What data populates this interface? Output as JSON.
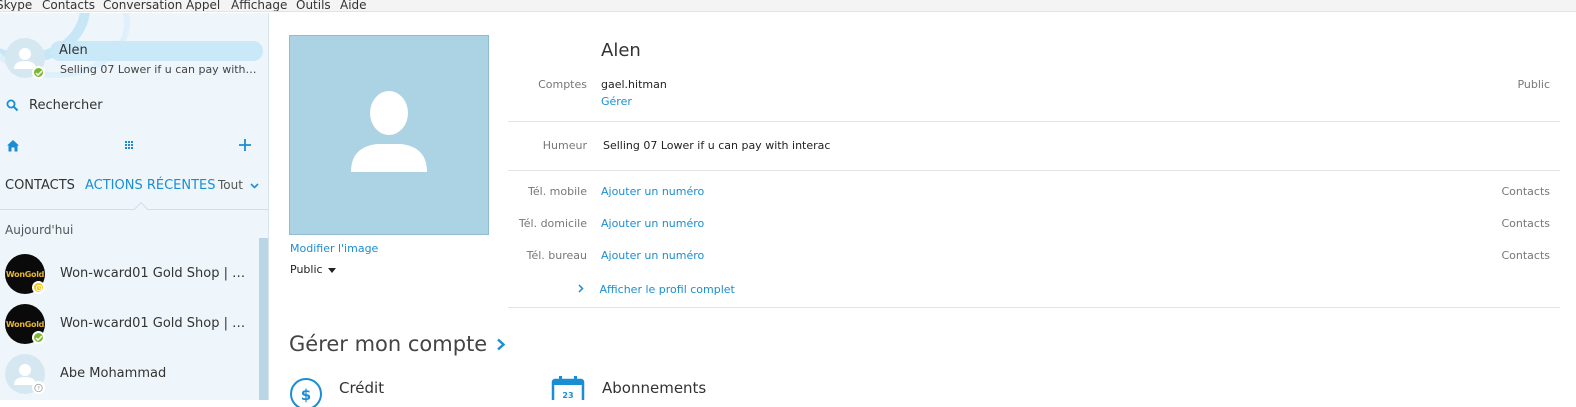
{
  "menu": [
    "Skype",
    "Contacts",
    "Conversation",
    "Appel",
    "Affichage",
    "Outils",
    "Aide"
  ],
  "me": {
    "name": "Alen",
    "mood": "Selling 07 Lower if u can pay with in..."
  },
  "search": {
    "label": "Rechercher"
  },
  "tabs": {
    "contacts": "CONTACTS",
    "recent": "ACTIONS RÉCENTES",
    "filter": "Tout"
  },
  "section_today": "Aujourd'hui",
  "contacts_list": [
    {
      "name": "Won-wcard01 Gold Shop | Al...",
      "avatar_text": "WonGold",
      "status": "away"
    },
    {
      "name": "Won-wcard01 Gold Shop |  b...",
      "avatar_text": "WonGold",
      "status": "online"
    },
    {
      "name": "Abe Mohammad",
      "avatar_text": "",
      "status": "unknown"
    }
  ],
  "profile": {
    "name": "Alen",
    "modify_image": "Modifier l'image",
    "visibility": "Public",
    "accounts_label": "Comptes",
    "account_id": "gael.hitman",
    "manage_link": "Gérer",
    "accounts_scope": "Public",
    "mood_label": "Humeur",
    "mood": "Selling 07 Lower if u can pay with interac",
    "phones": [
      {
        "label": "Tél. mobile",
        "action": "Ajouter un numéro",
        "scope": "Contacts"
      },
      {
        "label": "Tél. domicile",
        "action": "Ajouter un numéro",
        "scope": "Contacts"
      },
      {
        "label": "Tél. bureau",
        "action": "Ajouter un numéro",
        "scope": "Contacts"
      }
    ],
    "full_profile_link": "Afficher le profil complet"
  },
  "manage": {
    "title": "Gérer mon compte",
    "credit": "Crédit",
    "subscriptions": "Abonnements"
  },
  "colors": {
    "accent": "#1a8ed3",
    "online": "#7cb82f",
    "away": "#f5c400",
    "sidebar_bg": "#eef6fb"
  },
  "icons": [
    "search-icon",
    "home-icon",
    "dialpad-icon",
    "add-icon",
    "chevron-down-icon",
    "chevron-right-icon",
    "dollar-icon",
    "calendar-icon",
    "person-icon"
  ]
}
